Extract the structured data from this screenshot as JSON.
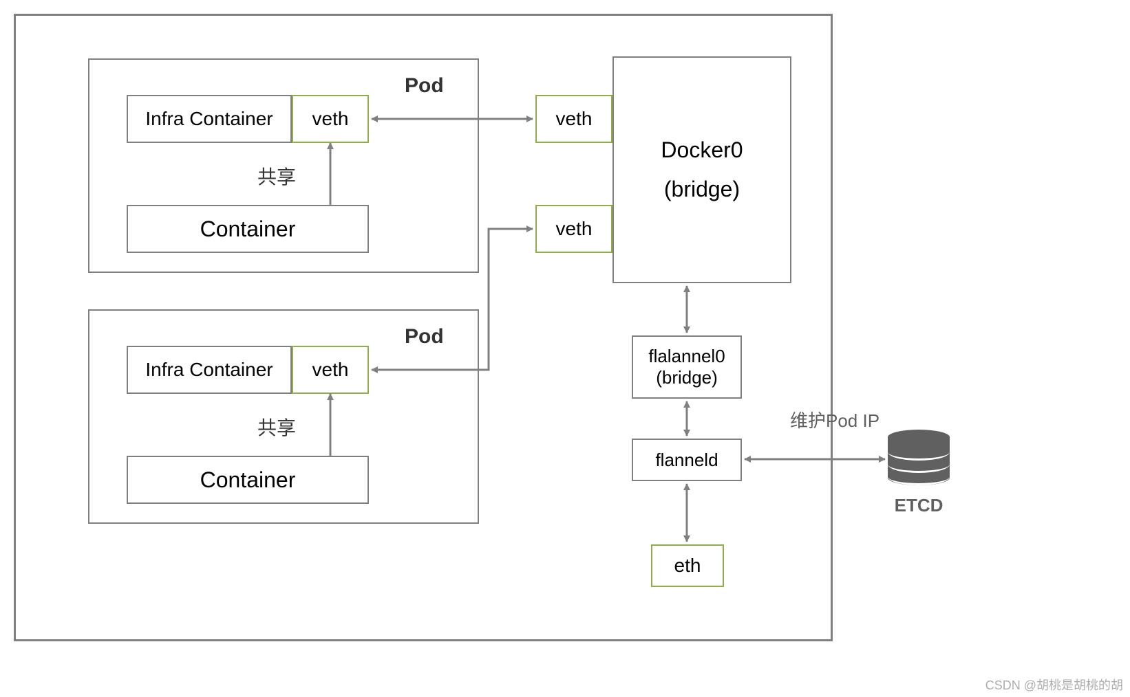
{
  "pod1": {
    "title": "Pod",
    "infra": "Infra Container",
    "veth": "veth",
    "share": "共享",
    "container": "Container"
  },
  "pod2": {
    "title": "Pod",
    "infra": "Infra Container",
    "veth": "veth",
    "share": "共享",
    "container": "Container"
  },
  "bridge_veth1": "veth",
  "bridge_veth2": "veth",
  "docker0": {
    "line1": "Docker0",
    "line2": "(bridge)"
  },
  "flannel0": {
    "line1": "flalannel0",
    "line2": "(bridge)"
  },
  "flanneld": "flanneld",
  "eth": "eth",
  "maintain_pod_ip": "维护Pod IP",
  "etcd": "ETCD",
  "watermark": "CSDN @胡桃是胡桃的胡"
}
